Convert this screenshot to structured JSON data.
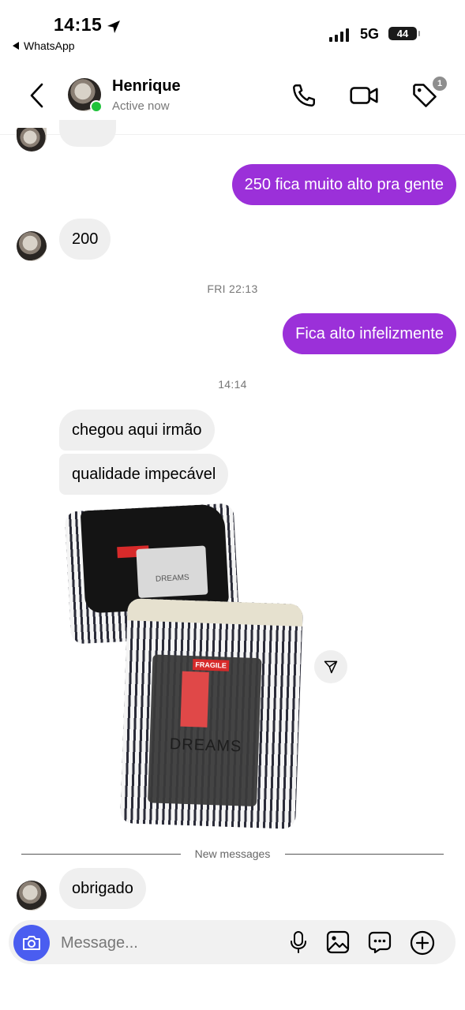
{
  "status_bar": {
    "time": "14:15",
    "back_app": "WhatsApp",
    "network": "5G",
    "battery": "44"
  },
  "header": {
    "name": "Henrique",
    "status": "Active now",
    "badge_count": "1"
  },
  "messages": {
    "partial_incoming": "...",
    "m1_out": "250 fica muito alto pra gente",
    "m2_in": "200",
    "ts1": "FRI 22:13",
    "m3_out": "Fica alto infelizmente",
    "ts2": "14:14",
    "m4_in": "chegou aqui irmão",
    "m5_in": "qualidade impecável",
    "new_messages_label": "New messages",
    "m6_in": "obrigado"
  },
  "photos": {
    "photo1_text": "DREAMS",
    "photo2_sticker": "FRAGILE",
    "photo2_text": "DREAMS"
  },
  "composer": {
    "placeholder": "Message..."
  },
  "colors": {
    "outgoing_bubble": "#9b30d9",
    "incoming_bubble": "#efefef",
    "camera_button": "#4a5df0",
    "online_dot": "#1ec23a"
  }
}
